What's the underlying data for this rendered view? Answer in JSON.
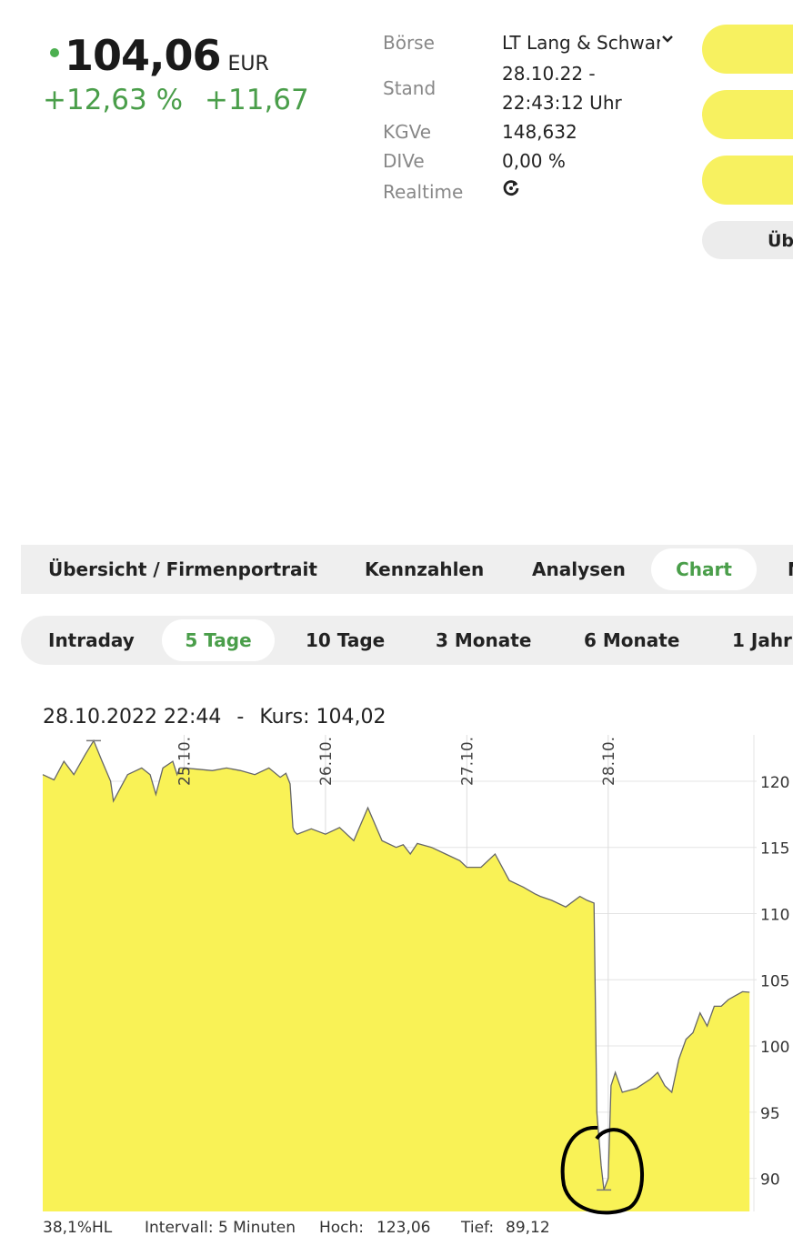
{
  "quote": {
    "price": "104,06",
    "currency": "EUR",
    "change_percent": "+12,63 %",
    "change_abs": "+11,67"
  },
  "info": {
    "exchange_label": "Börse",
    "exchange_value": "LT Lang & Schwarz",
    "stand_label": "Stand",
    "stand_date": "28.10.22 -",
    "stand_time": "22:43:12 Uhr",
    "kgv_label": "KGVe",
    "kgv_value": "148,632",
    "div_label": "DIVe",
    "div_value": "0,00 %",
    "realtime_label": "Realtime",
    "realtime_icon": "refresh-icon"
  },
  "side_buttons": {
    "overview_partial": "Üb"
  },
  "main_tabs": [
    {
      "label": "Übersicht / Firmenportrait",
      "active": false
    },
    {
      "label": "Kennzahlen",
      "active": false
    },
    {
      "label": "Analysen",
      "active": false
    },
    {
      "label": "Chart",
      "active": true
    },
    {
      "label": "N",
      "active": false
    }
  ],
  "period_tabs": [
    {
      "label": "Intraday",
      "active": false
    },
    {
      "label": "5 Tage",
      "active": true
    },
    {
      "label": "10 Tage",
      "active": false
    },
    {
      "label": "3 Monate",
      "active": false
    },
    {
      "label": "6 Monate",
      "active": false
    },
    {
      "label": "1 Jahr",
      "active": false
    }
  ],
  "chart_caption": {
    "datetime": "28.10.2022 22:44",
    "separator": "-",
    "price_text": "Kurs: 104,02"
  },
  "chart_footer": {
    "hl": "38,1%HL",
    "interval": "Intervall: 5 Minuten",
    "high_label": "Hoch:",
    "high_value": "123,06",
    "low_label": "Tief:",
    "low_value": "89,12"
  },
  "colors": {
    "accent_green": "#4a9e4a",
    "chart_fill": "#f9f256",
    "chart_line": "#666666",
    "button_yellow": "#f7f160"
  },
  "chart_data": {
    "type": "area",
    "ylim": [
      87.5,
      123.5
    ],
    "yticks": [
      90,
      95,
      100,
      105,
      110,
      115,
      120
    ],
    "day_labels": [
      "25.10.",
      "26.10.",
      "27.10.",
      "28.10."
    ],
    "day_boundaries": [
      1,
      2,
      3,
      4
    ],
    "xlim": [
      0,
      5.05
    ],
    "series": [
      {
        "x": [
          0,
          0.08,
          0.15,
          0.22,
          0.3,
          0.36,
          0.42,
          0.48,
          0.5,
          0.55,
          0.6,
          0.7,
          0.76,
          0.8,
          0.85,
          0.92,
          0.95,
          0.97,
          1.0,
          1.1,
          1.2,
          1.3,
          1.4,
          1.5,
          1.6,
          1.68,
          1.72,
          1.75,
          1.77,
          1.78,
          1.8,
          1.9,
          2.0,
          2.1,
          2.2,
          2.3,
          2.4,
          2.5,
          2.55,
          2.6,
          2.65,
          2.75,
          2.85,
          2.95,
          3.0,
          3.1,
          3.2,
          3.3,
          3.4,
          3.48,
          3.52,
          3.6,
          3.7,
          3.8,
          3.85,
          3.9,
          3.92,
          3.95,
          3.97,
          4.0,
          4.02,
          4.05,
          4.1,
          4.2,
          4.3,
          4.35,
          4.4,
          4.45,
          4.5,
          4.55,
          4.6,
          4.65,
          4.7,
          4.75,
          4.8,
          4.85,
          4.9,
          4.95,
          5.0
        ],
        "y": [
          120.5,
          120.1,
          121.5,
          120.5,
          122.0,
          123.06,
          121.5,
          120.0,
          118.5,
          119.5,
          120.5,
          121.0,
          120.5,
          119.0,
          121.0,
          121.5,
          120.5,
          121.0,
          121.0,
          120.9,
          120.8,
          121.0,
          120.8,
          120.5,
          121.0,
          120.3,
          120.6,
          119.8,
          116.5,
          116.2,
          116.0,
          116.4,
          116.0,
          116.5,
          115.5,
          118.0,
          115.5,
          115.0,
          115.2,
          114.5,
          115.3,
          115.0,
          114.5,
          114.0,
          113.5,
          113.5,
          114.5,
          112.5,
          112.0,
          111.5,
          111.3,
          111.0,
          110.5,
          111.3,
          111.0,
          110.8,
          95.0,
          91.0,
          89.12,
          90.0,
          97.0,
          98.0,
          96.5,
          96.8,
          97.5,
          98.0,
          97.0,
          96.5,
          99.0,
          100.5,
          101.0,
          102.5,
          101.5,
          103.0,
          103.0,
          103.5,
          103.8,
          104.1,
          104.06
        ]
      }
    ]
  }
}
